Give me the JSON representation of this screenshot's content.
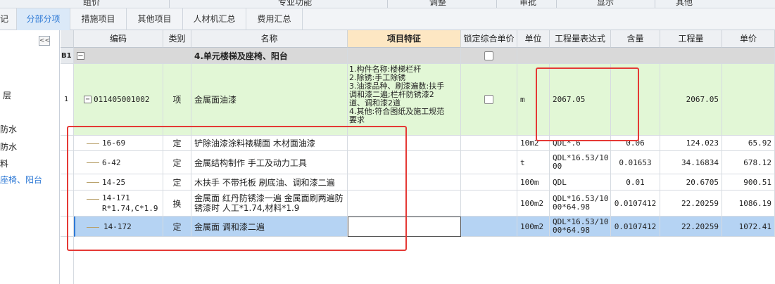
{
  "top_menu": [
    "组价",
    "专业功能",
    "调整",
    "审批",
    "显示",
    "其他"
  ],
  "tabs": [
    {
      "label": "记"
    },
    {
      "label": "分部分项",
      "active": true
    },
    {
      "label": "措施项目"
    },
    {
      "label": "其他项目"
    },
    {
      "label": "人材机汇总"
    },
    {
      "label": "费用汇总"
    }
  ],
  "sidebar": {
    "collapse_label": "<<",
    "items": [
      "层",
      "防水",
      "防水",
      "料",
      "座椅、阳台"
    ]
  },
  "columns": [
    "编码",
    "类别",
    "名称",
    "项目特征",
    "锁定综合单价",
    "单位",
    "工程量表达式",
    "含量",
    "工程量",
    "单价"
  ],
  "rows": {
    "b1": {
      "row_label": "B1",
      "toggle": "−",
      "name": "4.单元楼梯及座椅、阳台"
    },
    "r1": {
      "row_label": "1",
      "toggle": "−",
      "code": "011405001002",
      "type": "项",
      "name": "金属面油漆",
      "feature_lines": [
        "1.构件名称:楼梯栏杆",
        "2.除锈:手工除锈",
        "3.油漆品种、刷漆遍数:扶手",
        "调和漆二遍;栏杆防锈漆2",
        "道、调和漆2道",
        "4.其他:符合图纸及施工规范",
        "要求"
      ],
      "unit": "m",
      "qty_expr": "2067.05",
      "quantity": "2067.05"
    },
    "subs": [
      {
        "code": "16-69",
        "type": "定",
        "name": "铲除油漆涂料裱糊面 木材面油漆",
        "unit": "10m2",
        "qty_expr": "QDL*.6",
        "content": "0.06",
        "quantity": "124.023",
        "price": "65.92"
      },
      {
        "code": "6-42",
        "type": "定",
        "name": "金属结构制作 手工及动力工具",
        "unit": "t",
        "qty_expr": "QDL*16.53/1000",
        "content": "0.01653",
        "quantity": "34.16834",
        "price": "678.12"
      },
      {
        "code": "14-25",
        "type": "定",
        "name": "木扶手 不带托板 刷底油、调和漆二遍",
        "unit": "100m",
        "qty_expr": "QDL",
        "content": "0.01",
        "quantity": "20.6705",
        "price": "900.51"
      },
      {
        "code": "14-171",
        "code_extra": "R*1.74,C*1.9",
        "type": "换",
        "name": "金属面 红丹防锈漆一遍  金属面刷两遍防锈漆时 人工*1.74,材料*1.9",
        "unit": "100m2",
        "qty_expr": "QDL*16.53/1000*64.98",
        "content": "0.0107412",
        "quantity": "22.20259",
        "price": "1086.19"
      },
      {
        "code": "14-172",
        "type": "定",
        "name": "金属面 调和漆二遍",
        "unit": "100m2",
        "qty_expr": "QDL*16.53/1000*64.98",
        "content": "0.0107412",
        "quantity": "22.20259",
        "price": "1072.41"
      }
    ]
  },
  "colors": {
    "accent": "#2f7ad6",
    "section_row": "#d9d9d9",
    "item_row": "#e2f7d6",
    "selected_row": "#b5d3f3",
    "highlight_box": "#e53935"
  }
}
